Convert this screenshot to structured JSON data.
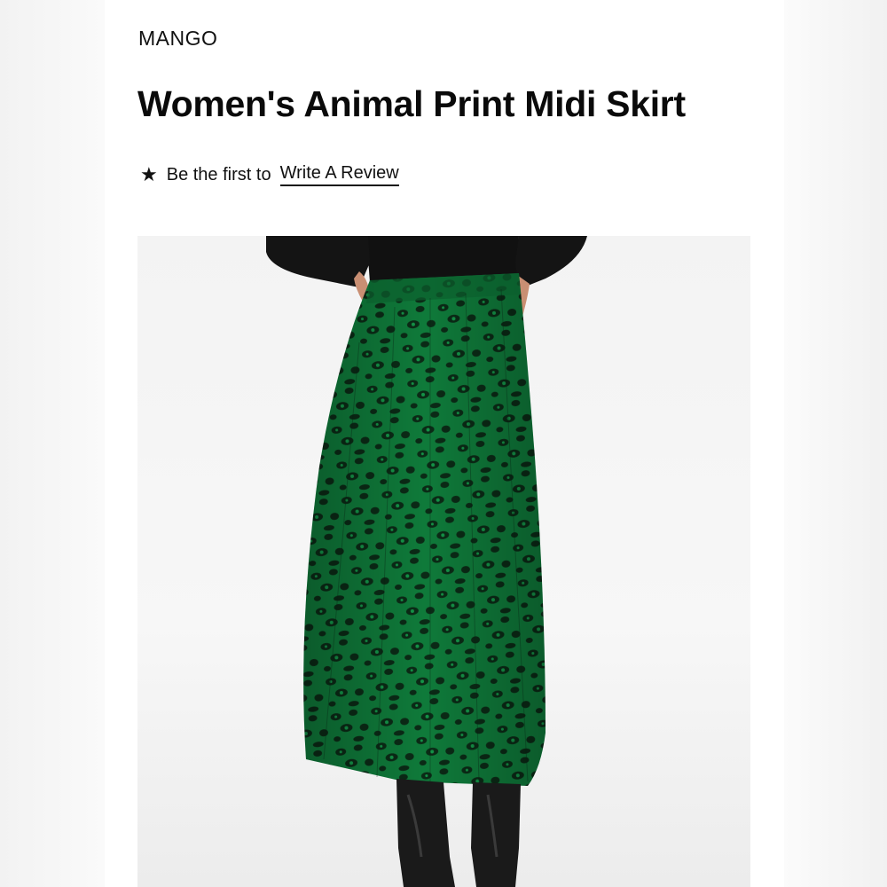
{
  "product": {
    "brand": "MANGO",
    "title": "Women's Animal Print Midi Skirt",
    "review_prompt": "Be the first to",
    "review_link": "Write A Review",
    "star_icon": "★"
  },
  "colors": {
    "skirt_green": "#0f7a3a",
    "skirt_dark": "#0b2a16",
    "top_black": "#111111",
    "background": "#ffffff"
  }
}
